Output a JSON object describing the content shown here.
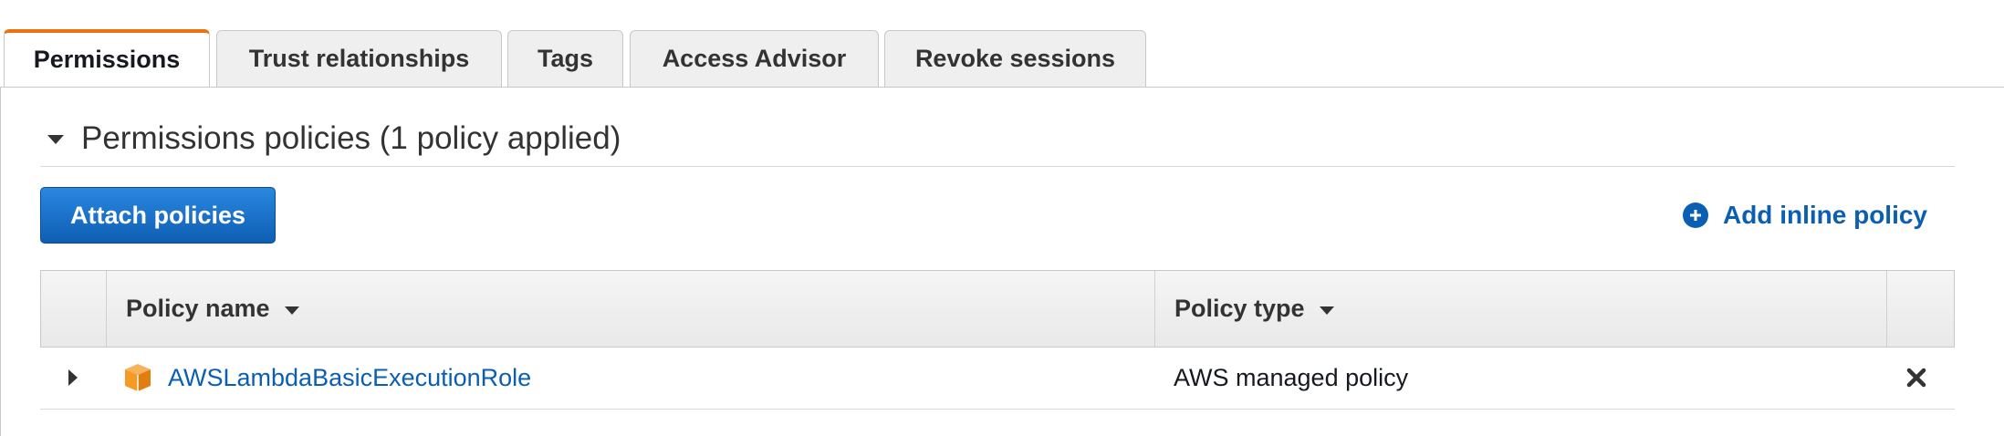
{
  "tabs": [
    {
      "label": "Permissions",
      "active": true
    },
    {
      "label": "Trust relationships",
      "active": false
    },
    {
      "label": "Tags",
      "active": false
    },
    {
      "label": "Access Advisor",
      "active": false
    },
    {
      "label": "Revoke sessions",
      "active": false
    }
  ],
  "section": {
    "title": "Permissions policies (1 policy applied)",
    "expanded": true
  },
  "actions": {
    "attach_label": "Attach policies",
    "add_inline_label": "Add inline policy",
    "add_inline_icon": "plus-circle-icon"
  },
  "table": {
    "columns": [
      "Policy name",
      "Policy type"
    ],
    "rows": [
      {
        "name": "AWSLambdaBasicExecutionRole",
        "type": "AWS managed policy",
        "icon": "aws-managed-policy-cube-icon"
      }
    ]
  },
  "colors": {
    "accent_tab": "#ec7211",
    "primary_button": "#1166bb",
    "link": "#0a5fb3",
    "policy_icon": "#f59a23"
  }
}
